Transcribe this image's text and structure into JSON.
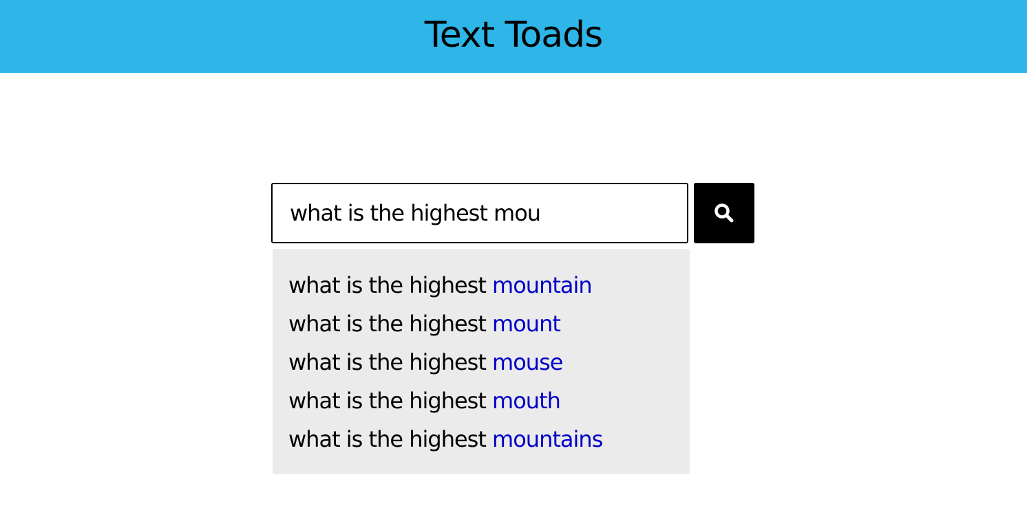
{
  "header": {
    "title": "Text Toads",
    "background_color": "#2eb6e8"
  },
  "search": {
    "value": "what is the highest mou",
    "button_icon": "search-icon"
  },
  "suggestions": [
    {
      "prefix": "what is the highest ",
      "completion": "mountain"
    },
    {
      "prefix": "what is the highest ",
      "completion": "mount"
    },
    {
      "prefix": "what is the highest ",
      "completion": "mouse"
    },
    {
      "prefix": "what is the highest ",
      "completion": "mouth"
    },
    {
      "prefix": "what is the highest ",
      "completion": "mountains"
    }
  ],
  "colors": {
    "completion_text": "#0000c8",
    "suggestions_background": "#ebebeb"
  }
}
